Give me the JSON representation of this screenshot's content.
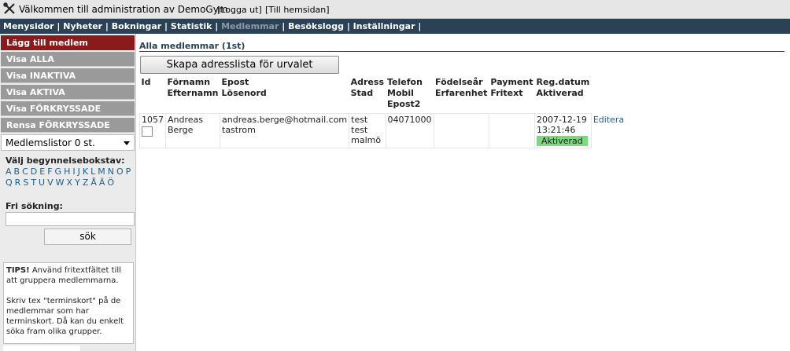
{
  "topbar": {
    "title": "Välkommen till administration av DemoGym",
    "logout_label": "[Logga ut]",
    "site_label": "[Till hemsidan]"
  },
  "menu": [
    {
      "label": "Menysidor",
      "active": false
    },
    {
      "label": "Nyheter",
      "active": false
    },
    {
      "label": "Bokningar",
      "active": false
    },
    {
      "label": "Statistik",
      "active": false
    },
    {
      "label": "Medlemmar",
      "active": true
    },
    {
      "label": "Besökslogg",
      "active": false
    },
    {
      "label": "Inställningar",
      "active": false
    }
  ],
  "sidebar": {
    "add_member": "Lägg till medlem",
    "show_all": "Visa ALLA",
    "show_inactive": "Visa INAKTIVA",
    "show_active": "Visa AKTIVA",
    "show_checked": "Visa FÖRKRYSSADE",
    "clear_checked": "Rensa FÖRKRYSSADE",
    "member_lists_select": "Medlemslistor 0 st.",
    "letter_label": "Välj begynnelsebokstav:",
    "letters_row1": [
      "A",
      "B",
      "C",
      "D",
      "E",
      "F",
      "G",
      "H",
      "I",
      "J",
      "K",
      "L",
      "M",
      "N",
      "O",
      "P"
    ],
    "letters_row2": [
      "Q",
      "R",
      "S",
      "T",
      "U",
      "V",
      "W",
      "X",
      "Y",
      "Z",
      "Å",
      "Ä",
      "Ö"
    ],
    "free_search_label": "Fri sökning:",
    "search_value": "",
    "search_button": "sök",
    "tips_title": "TIPS!",
    "tips_text1": " Använd fritextfältet till att gruppera medlemmarna.",
    "tips_text2": "Skriv tex \"terminskort\" på de medlemmar som har terminskort. Då kan du enkelt söka fram olika grupper."
  },
  "main": {
    "heading": "Alla medlemmar (1st)",
    "create_button": "Skapa adresslista för urvalet",
    "columns": [
      {
        "lines": [
          "Id"
        ]
      },
      {
        "lines": [
          "Förnamn",
          "Efternamn"
        ]
      },
      {
        "lines": [
          "Epost",
          "Lösenord"
        ]
      },
      {
        "lines": [
          "Adress",
          "Stad"
        ]
      },
      {
        "lines": [
          "Telefon",
          "Mobil",
          "Epost2"
        ]
      },
      {
        "lines": [
          "Födelseår",
          "Erfarenhet"
        ]
      },
      {
        "lines": [
          "Payment",
          "Fritext"
        ]
      },
      {
        "lines": [
          "Reg.datum",
          "Aktiverad"
        ]
      }
    ],
    "rows": [
      {
        "id": "1057",
        "first_name": "Andreas",
        "last_name": "Berge",
        "email": "andreas.berge@hotmail.com",
        "password": "tastrom",
        "address": "test test",
        "city": "malmö",
        "phone": "04071000",
        "birth_year": "",
        "payment": "",
        "reg_date": "2007-12-19",
        "reg_time": "13:21:46",
        "status": "Aktiverad",
        "edit_label": "Editera"
      }
    ]
  },
  "colors": {
    "menubar_bg": "#2b4256",
    "add_member_bg": "#8b1a1a",
    "sidebar_button_bg": "#9a9a9a",
    "link": "#1e5d8c",
    "status_badge": "#7fd87f"
  }
}
